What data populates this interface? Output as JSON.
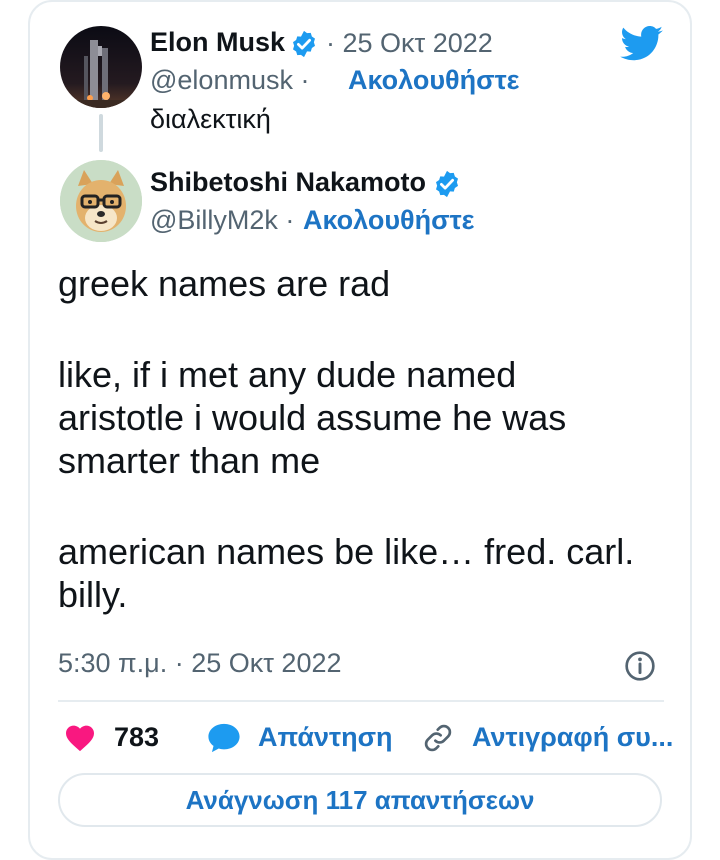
{
  "parent_tweet": {
    "author_name": "Elon Musk",
    "date": "· 25 Οκτ 2022",
    "handle": "@elonmusk ·",
    "follow_label": "Ακολουθήστε",
    "text": "διαλεκτική"
  },
  "reply_tweet": {
    "author_name": "Shibetoshi Nakamoto",
    "handle": "@BillyM2k ·",
    "follow_label": "Ακολουθήστε",
    "lines": [
      "greek names are rad",
      "like, if i met any dude named",
      "aristotle i would assume he was",
      "smarter than me",
      "american names be like… fred. carl.",
      "billy."
    ],
    "timestamp": "5:30 π.μ. · 25 Οκτ 2022"
  },
  "actions": {
    "likes": "783",
    "reply_label": "Απάντηση",
    "copy_label": "Αντιγραφή συ..."
  },
  "read_replies_label": "Ανάγνωση 117 απαντήσεων",
  "colors": {
    "accent": "#1d74c4",
    "twitter_blue": "#1d9bf0",
    "like": "#f91880",
    "muted": "#536471"
  },
  "icons": [
    "twitter-bird-icon",
    "verified-badge-icon",
    "info-icon",
    "heart-icon",
    "reply-bubble-icon",
    "link-icon"
  ]
}
